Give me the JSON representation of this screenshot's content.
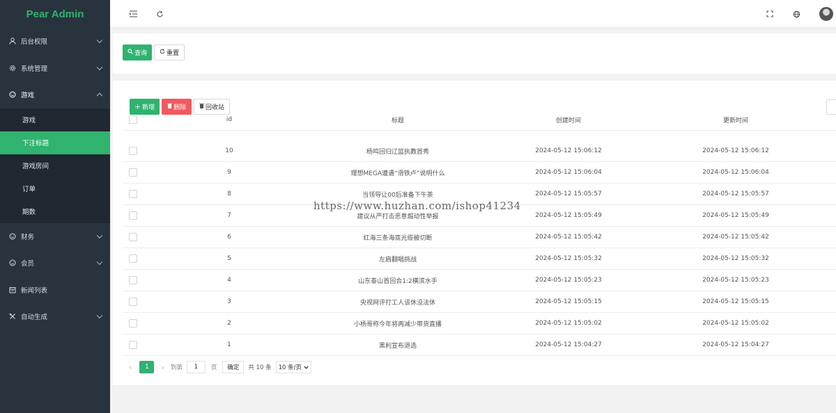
{
  "app": {
    "logo": "Pear Admin"
  },
  "sidebar": {
    "items": [
      {
        "label": "后台权限",
        "icon": "user-icon"
      },
      {
        "label": "系统管理",
        "icon": "gear-icon"
      },
      {
        "label": "游戏",
        "icon": "smile-icon"
      },
      {
        "label": "财务",
        "icon": "smile-icon"
      },
      {
        "label": "会员",
        "icon": "smile-icon"
      },
      {
        "label": "新闻列表",
        "icon": "calendar-icon"
      },
      {
        "label": "自动生成",
        "icon": "tools-icon"
      }
    ],
    "submenu": [
      "游戏",
      "下注标题",
      "游戏房间",
      "订单",
      "期数"
    ],
    "active_sub": "下注标题"
  },
  "query": {
    "search_label": "查询",
    "reset_label": "重置"
  },
  "toolbar": {
    "add_label": "新增",
    "delete_label": "删除",
    "recycle_label": "回收站"
  },
  "table": {
    "headers": [
      "id",
      "标题",
      "创建时间",
      "更新时间"
    ],
    "rows": [
      {
        "id": "10",
        "title": "杨鸣回归辽篮执教首秀",
        "created": "2024-05-12 15:06:12",
        "updated": "2024-05-12 15:06:12"
      },
      {
        "id": "9",
        "title": "理想MEGA遭遇“滑铁卢”说明什么",
        "created": "2024-05-12 15:06:04",
        "updated": "2024-05-12 15:06:04"
      },
      {
        "id": "8",
        "title": "当领导让00后准备下午茶",
        "created": "2024-05-12 15:05:57",
        "updated": "2024-05-12 15:05:57"
      },
      {
        "id": "7",
        "title": "建议从严打击恶意煽动性举报",
        "created": "2024-05-12 15:05:49",
        "updated": "2024-05-12 15:05:49"
      },
      {
        "id": "6",
        "title": "红海三条海底光缆被切断",
        "created": "2024-05-12 15:05:42",
        "updated": "2024-05-12 15:05:42"
      },
      {
        "id": "5",
        "title": "左肩翻唱挑战",
        "created": "2024-05-12 15:05:32",
        "updated": "2024-05-12 15:05:32"
      },
      {
        "id": "4",
        "title": "山东泰山首回合1:2横滨水手",
        "created": "2024-05-12 15:05:23",
        "updated": "2024-05-12 15:05:23"
      },
      {
        "id": "3",
        "title": "央视网评打工人该休没法休",
        "created": "2024-05-12 15:05:15",
        "updated": "2024-05-12 15:05:15"
      },
      {
        "id": "2",
        "title": "小杨哥称今年将再减少带货直播",
        "created": "2024-05-12 15:05:02",
        "updated": "2024-05-12 15:05:02"
      },
      {
        "id": "1",
        "title": "黑利宣布退选",
        "created": "2024-05-12 15:04:27",
        "updated": "2024-05-12 15:04:27"
      }
    ]
  },
  "pager": {
    "current": "1",
    "goto_label": "到第",
    "page_value": "1",
    "page_unit": "页",
    "confirm": "确定",
    "total": "共 10 条",
    "size": "10 条/页"
  },
  "watermark": "https://www.huzhan.com/ishop41234",
  "colors": {
    "accent": "#2fb36f",
    "danger": "#f15a5f",
    "sidebar": "#28333e"
  }
}
